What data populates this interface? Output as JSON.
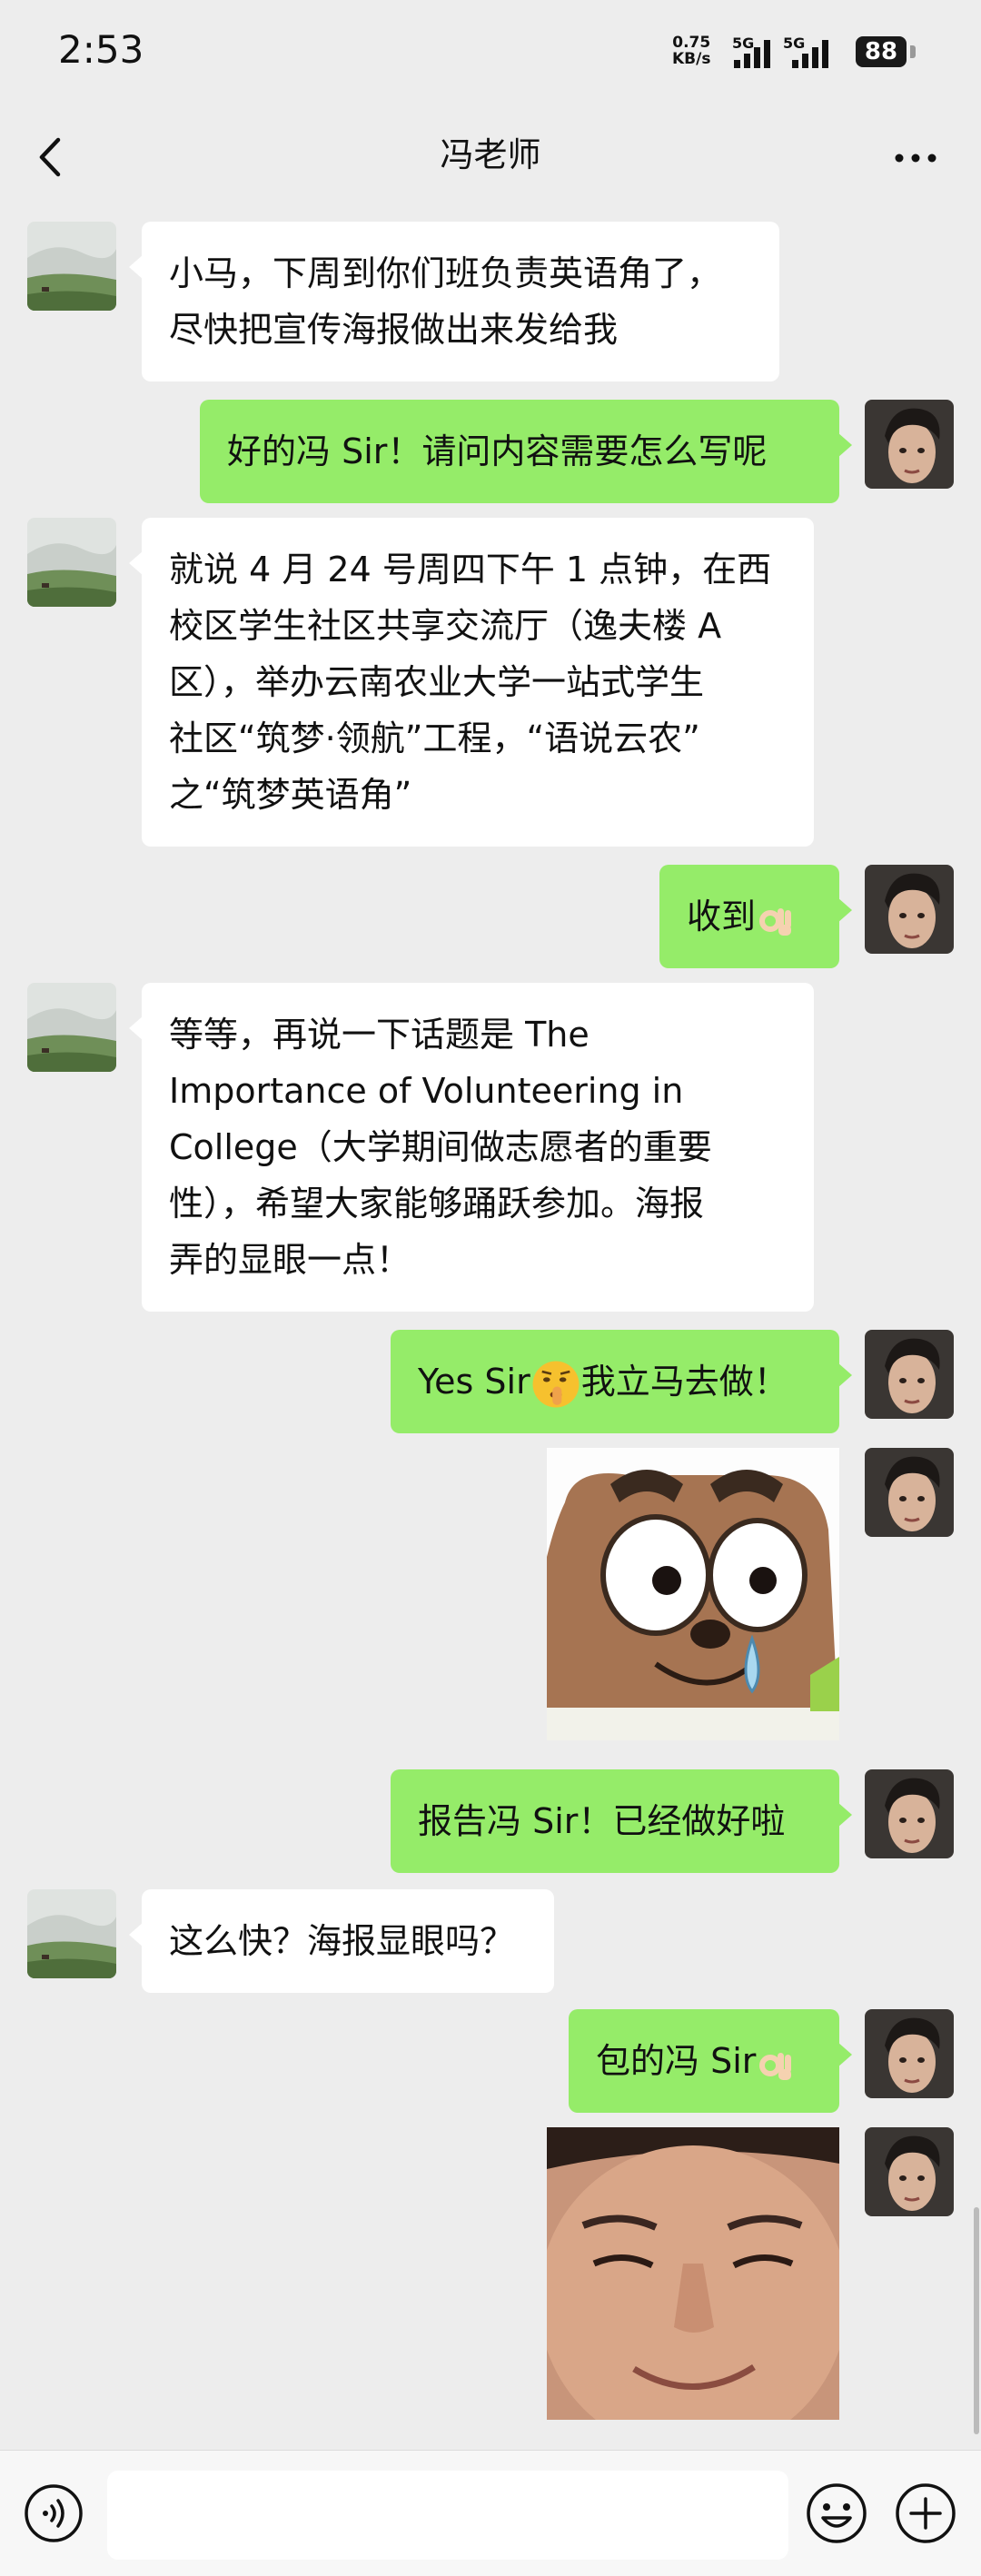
{
  "status_bar": {
    "time": "2:53",
    "net_speed_value": "0.75",
    "net_speed_unit": "KB/s",
    "sim1_label": "5G",
    "sim2_label": "5G",
    "battery": "88"
  },
  "header": {
    "title": "冯老师",
    "back_icon": "chevron-left-icon",
    "more_icon": "more-dots-icon"
  },
  "messages": [
    {
      "from": "teacher",
      "type": "text",
      "text": "小马，下周到你们班负责英语角了，\n尽快把宣传海报做出来发给我"
    },
    {
      "from": "me",
      "type": "text",
      "text": "好的冯 Sir！请问内容需要怎么写呢"
    },
    {
      "from": "teacher",
      "type": "text",
      "text": "就说 4 月 24 号周四下午 1 点钟，在西\n校区学生社区共享交流厅（逸夫楼 A\n区），举办云南农业大学一站式学生\n社区“筑梦·领航”工程，“语说云农”\n之“筑梦英语角”"
    },
    {
      "from": "me",
      "type": "text",
      "text": "收到",
      "emoji": "ok-hand-emoji"
    },
    {
      "from": "teacher",
      "type": "text",
      "text": "等等，再说一下话题是 The\nImportance of Volunteering in\nCollege（大学期间做志愿者的重要\n性），希望大家能够踊跃参加。海报\n弄的显眼一点！"
    },
    {
      "from": "me",
      "type": "text",
      "text_before": "Yes Sir",
      "emoji": "shushing-face-emoji",
      "text_after": "我立马去做！"
    },
    {
      "from": "me",
      "type": "sticker",
      "sticker": "cartoon-bear-crying-sticker"
    },
    {
      "from": "me",
      "type": "text",
      "text": "报告冯 Sir！已经做好啦"
    },
    {
      "from": "teacher",
      "type": "text",
      "text": "这么快？海报显眼吗？"
    },
    {
      "from": "me",
      "type": "text",
      "text": "包的冯 Sir",
      "emoji": "ok-hand-emoji"
    },
    {
      "from": "me",
      "type": "sticker",
      "sticker": "smiling-face-photo-sticker"
    }
  ],
  "input_bar": {
    "voice_icon": "voice-input-icon",
    "emoji_icon": "emoji-icon",
    "plus_icon": "plus-icon",
    "placeholder": ""
  },
  "colors": {
    "background": "#ededed",
    "incoming_bubble": "#ffffff",
    "outgoing_bubble": "#95ec69",
    "input_bar": "#f7f7f7"
  }
}
